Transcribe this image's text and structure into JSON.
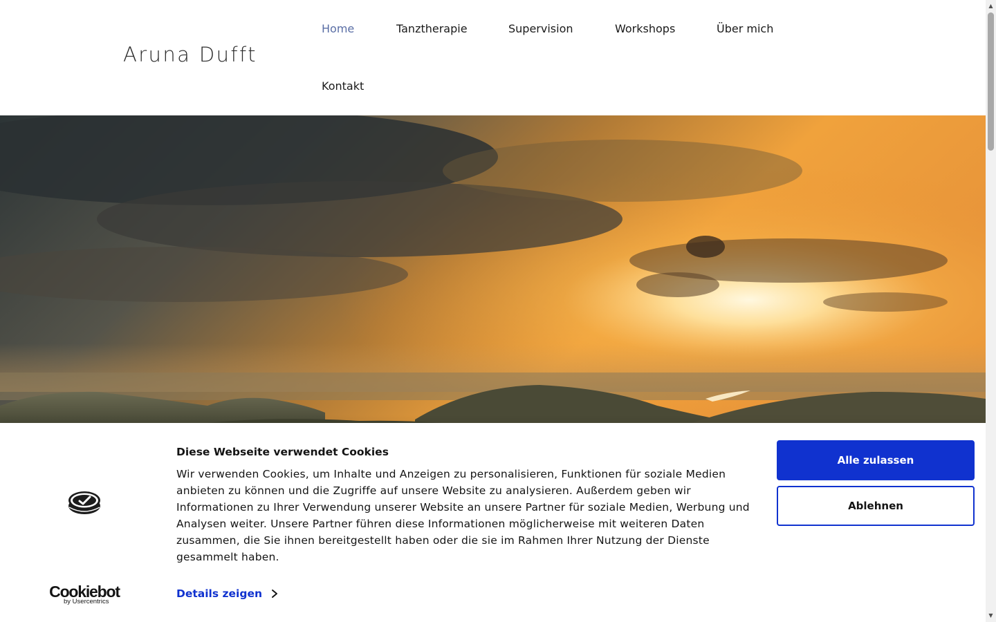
{
  "header": {
    "site_title": "Aruna Dufft",
    "nav": [
      {
        "label": "Home",
        "active": true
      },
      {
        "label": "Tanztherapie",
        "active": false
      },
      {
        "label": "Supervision",
        "active": false
      },
      {
        "label": "Workshops",
        "active": false
      },
      {
        "label": "Über mich",
        "active": false
      },
      {
        "label": "Kontakt",
        "active": false
      }
    ]
  },
  "hero": {
    "image": "sunset-over-hills-landscape"
  },
  "cookie_banner": {
    "brand_name": "Cookiebot",
    "brand_sub": "by Usercentrics",
    "title": "Diese Webseite verwendet Cookies",
    "text": "Wir verwenden Cookies, um Inhalte und Anzeigen zu personalisieren, Funktionen für soziale Medien anbieten zu können und die Zugriffe auf unsere Website zu analysieren. Außerdem geben wir Informationen zu Ihrer Verwendung unserer Website an unsere Partner für soziale Medien, Werbung und Analysen weiter. Unsere Partner führen diese Informationen möglicherweise mit weiteren Daten zusammen, die Sie ihnen bereitgestellt haben oder die sie im Rahmen Ihrer Nutzung der Dienste gesammelt haben.",
    "details_link": "Details zeigen",
    "accept_label": "Alle zulassen",
    "decline_label": "Ablehnen"
  },
  "colors": {
    "nav_active": "#5a6ea5",
    "accent": "#1032cf"
  }
}
